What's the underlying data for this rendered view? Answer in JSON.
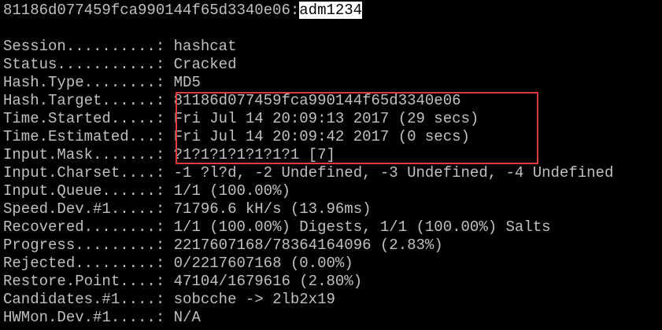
{
  "result": {
    "hash": "81186d077459fca990144f65d3340e06",
    "separator": ":",
    "password": "adm1234"
  },
  "status_lines": [
    {
      "label": "Session..........",
      "value": "hashcat"
    },
    {
      "label": "Status...........",
      "value": "Cracked"
    },
    {
      "label": "Hash.Type........",
      "value": "MD5"
    },
    {
      "label": "Hash.Target......",
      "value": "81186d077459fca990144f65d3340e06"
    },
    {
      "label": "Time.Started.....",
      "value": "Fri Jul 14 20:09:13 2017 (29 secs)"
    },
    {
      "label": "Time.Estimated...",
      "value": "Fri Jul 14 20:09:42 2017 (0 secs)"
    },
    {
      "label": "Input.Mask.......",
      "value": "?1?1?1?1?1?1?1 [7]"
    },
    {
      "label": "Input.Charset....",
      "value": "-1 ?l?d, -2 Undefined, -3 Undefined, -4 Undefined"
    },
    {
      "label": "Input.Queue......",
      "value": "1/1 (100.00%)"
    },
    {
      "label": "Speed.Dev.#1.....",
      "value": "71796.6 kH/s (13.96ms)"
    },
    {
      "label": "Recovered........",
      "value": "1/1 (100.00%) Digests, 1/1 (100.00%) Salts"
    },
    {
      "label": "Progress.........",
      "value": "2217607168/78364164096 (2.83%)"
    },
    {
      "label": "Rejected.........",
      "value": "0/2217607168 (0.00%)"
    },
    {
      "label": "Restore.Point....",
      "value": "47104/1679616 (2.80%)"
    },
    {
      "label": "Candidates.#1....",
      "value": "sobcche -> 2lb2x19"
    },
    {
      "label": "HWMon.Dev.#1.....",
      "value": "N/A"
    }
  ],
  "label_separator": ": ",
  "colors": {
    "background": "#000000",
    "text": "#c0c0c0",
    "highlight_bg": "#ffffff",
    "highlight_text": "#000000",
    "annotation_box": "#e03c3c"
  }
}
